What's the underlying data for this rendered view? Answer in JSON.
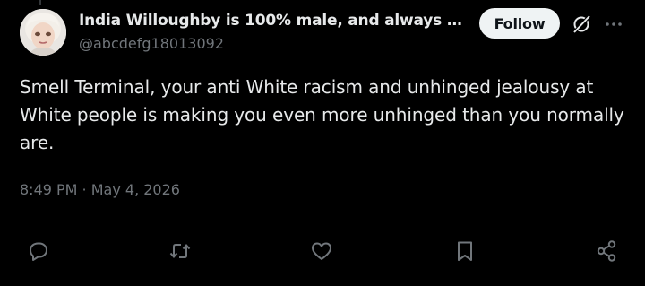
{
  "author": {
    "display_name": "India Willoughby is 100% male, and always w...",
    "handle": "@abcdefg18013092",
    "avatar_icon": "avatar-image"
  },
  "header": {
    "follow_label": "Follow",
    "grok_icon": "grok-icon",
    "more_icon": "more-icon"
  },
  "tweet": {
    "text": "Smell Terminal, your anti White racism and unhinged jealousy at White people is making you even more unhinged than you normally are.",
    "timestamp": "8:49 PM · May 4, 2026"
  },
  "actions": [
    {
      "name": "reply",
      "icon": "reply-icon"
    },
    {
      "name": "repost",
      "icon": "repost-icon"
    },
    {
      "name": "like",
      "icon": "like-icon"
    },
    {
      "name": "bookmark",
      "icon": "bookmark-icon"
    },
    {
      "name": "share",
      "icon": "share-icon"
    }
  ],
  "colors": {
    "background": "#000000",
    "text_primary": "#e7e9ea",
    "text_secondary": "#71767b",
    "divider": "#2f3336",
    "follow_bg": "#eff3f4",
    "follow_text": "#0f1419"
  }
}
